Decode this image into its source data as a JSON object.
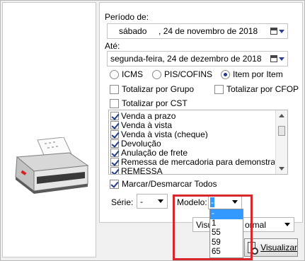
{
  "periodo": {
    "label": "Período de:",
    "date": "sábado     , 24 de novembro de 2018"
  },
  "ate": {
    "label": "Até:",
    "date": "segunda-feira, 24 de dezembro de 2018"
  },
  "radios": [
    {
      "label": "ICMS",
      "checked": false
    },
    {
      "label": "PIS/COFINS",
      "checked": false
    },
    {
      "label": "Item por Item",
      "checked": true
    }
  ],
  "checks": {
    "totalizar_grupo": "Totalizar por Grupo",
    "totalizar_cfop": "Totalizar por CFOP",
    "totalizar_cst": "Totalizar por CST"
  },
  "list_items": [
    "Venda a prazo",
    "Venda à vista",
    "Venda à vista (cheque)",
    "Devolução",
    "Anulação de frete",
    "Remessa de mercadoria para demonstração",
    "REMESSA"
  ],
  "marcar_todos": "Marcar/Desmarcar Todos",
  "serie": {
    "label": "Série:",
    "value": "-"
  },
  "modelo": {
    "label": "Modelo:",
    "value": "-",
    "options": [
      "-",
      "1",
      "55",
      "59",
      "65"
    ],
    "selected": "-"
  },
  "visualizacao": {
    "value_left": "Visua",
    "value_right": "ormal"
  },
  "visualizar_button": "Visualizar",
  "icons": {
    "printer": "printer-icon",
    "calendar": "calendar-icon",
    "preview": "document-preview-icon"
  },
  "colors": {
    "highlight_red": "#d7262c",
    "selection_blue": "#3399ff"
  }
}
